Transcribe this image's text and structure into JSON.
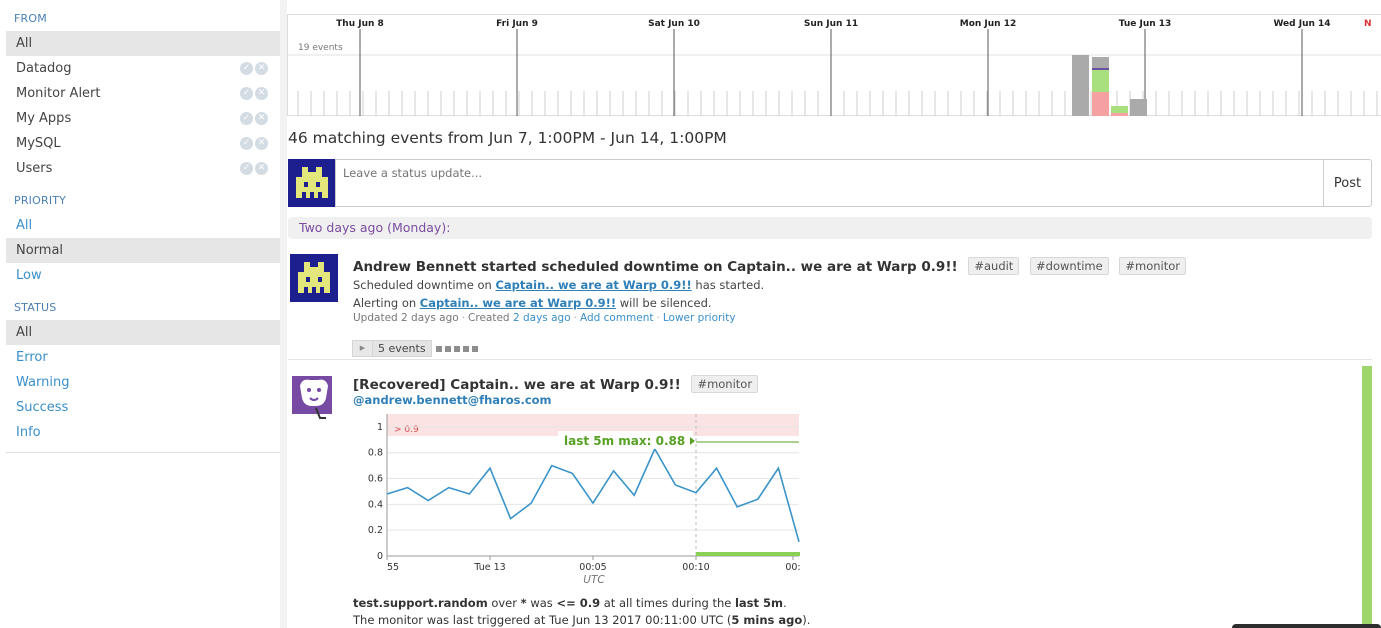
{
  "sidebar": {
    "from_title": "FROM",
    "from_items": [
      "All",
      "Datadog",
      "Monitor Alert",
      "My Apps",
      "MySQL",
      "Users"
    ],
    "priority_title": "PRIORITY",
    "priority_items": [
      "All",
      "Normal",
      "Low"
    ],
    "status_title": "STATUS",
    "status_items": [
      "All",
      "Error",
      "Warning",
      "Success",
      "Info"
    ],
    "icons": {
      "check": "check-circle-icon",
      "remove": "x-circle-icon"
    }
  },
  "timeline": {
    "day_labels": [
      "Thu Jun 8",
      "Fri Jun 9",
      "Sat Jun 10",
      "Sun Jun 11",
      "Mon Jun 12",
      "Tue Jun 13",
      "Wed Jun 14"
    ],
    "y_label": "19 events",
    "colors": {
      "gray": "#aaaaaa",
      "green": "#a9e07f",
      "red": "#f5a1a1",
      "purple": "#6b4fa0"
    }
  },
  "matching_text": "46 matching events from Jun 7, 1:00PM - Jun 14, 1:00PM",
  "status_update": {
    "placeholder": "Leave a status update...",
    "post_label": "Post"
  },
  "day_header": "Two days ago (Monday):",
  "event1": {
    "title": "Andrew Bennett started scheduled downtime on Captain.. we are at Warp 0.9!!",
    "tags": [
      "#audit",
      "#downtime",
      "#monitor"
    ],
    "line1_pre": "Scheduled downtime on ",
    "line1_link": "Captain.. we are at Warp 0.9!!",
    "line1_post": " has started.",
    "line2_pre": "Alerting on ",
    "line2_link": "Captain.. we are at Warp 0.9!!",
    "line2_post": " will be silenced.",
    "updated": "Updated 2 days ago",
    "created_pre": "Created ",
    "created_link": "2 days ago",
    "add_comment": "Add comment",
    "lower_priority": "Lower priority",
    "expand_label": "5 events"
  },
  "event2": {
    "title": "[Recovered] Captain.. we are at Warp 0.9!!",
    "tag": "#monitor",
    "user": "@andrew.bennett@fharos.com",
    "desc1_metric": "test.support.random",
    "desc1_mid": " over ",
    "desc1_star": "*",
    "desc1_was": " was ",
    "desc1_cond": "<= 0.9",
    "desc1_tail": " at all times during the ",
    "desc1_window": "last 5m",
    "desc1_end": ".",
    "desc2_pre": "The monitor was last triggered at Tue Jun 13 2017 00:11:00 UTC (",
    "desc2_bold": "5 mins ago",
    "desc2_end": ")."
  },
  "chart_data": {
    "type": "line",
    "threshold_label": "> 0.9",
    "annotation": "last 5m max: 0.88",
    "xlabel": "UTC",
    "x_tick_labels": [
      "55",
      "Tue 13",
      "00:05",
      "00:10",
      "00:"
    ],
    "y_tick_labels": [
      "1",
      "0.8",
      "0.6",
      "0.4",
      "0.2",
      "0"
    ],
    "ylim": [
      0,
      1.1
    ],
    "threshold": 0.9,
    "series": [
      {
        "values": [
          0.48,
          0.53,
          0.43,
          0.53,
          0.48,
          0.68,
          0.29,
          0.41,
          0.7,
          0.64,
          0.41,
          0.66,
          0.47,
          0.83,
          0.55,
          0.49,
          0.68,
          0.38,
          0.44,
          0.68,
          0.11
        ]
      }
    ],
    "colors": {
      "line": "#3a94c9",
      "threshold_band": "#fbe3e3",
      "annotation": "#57a225"
    }
  }
}
